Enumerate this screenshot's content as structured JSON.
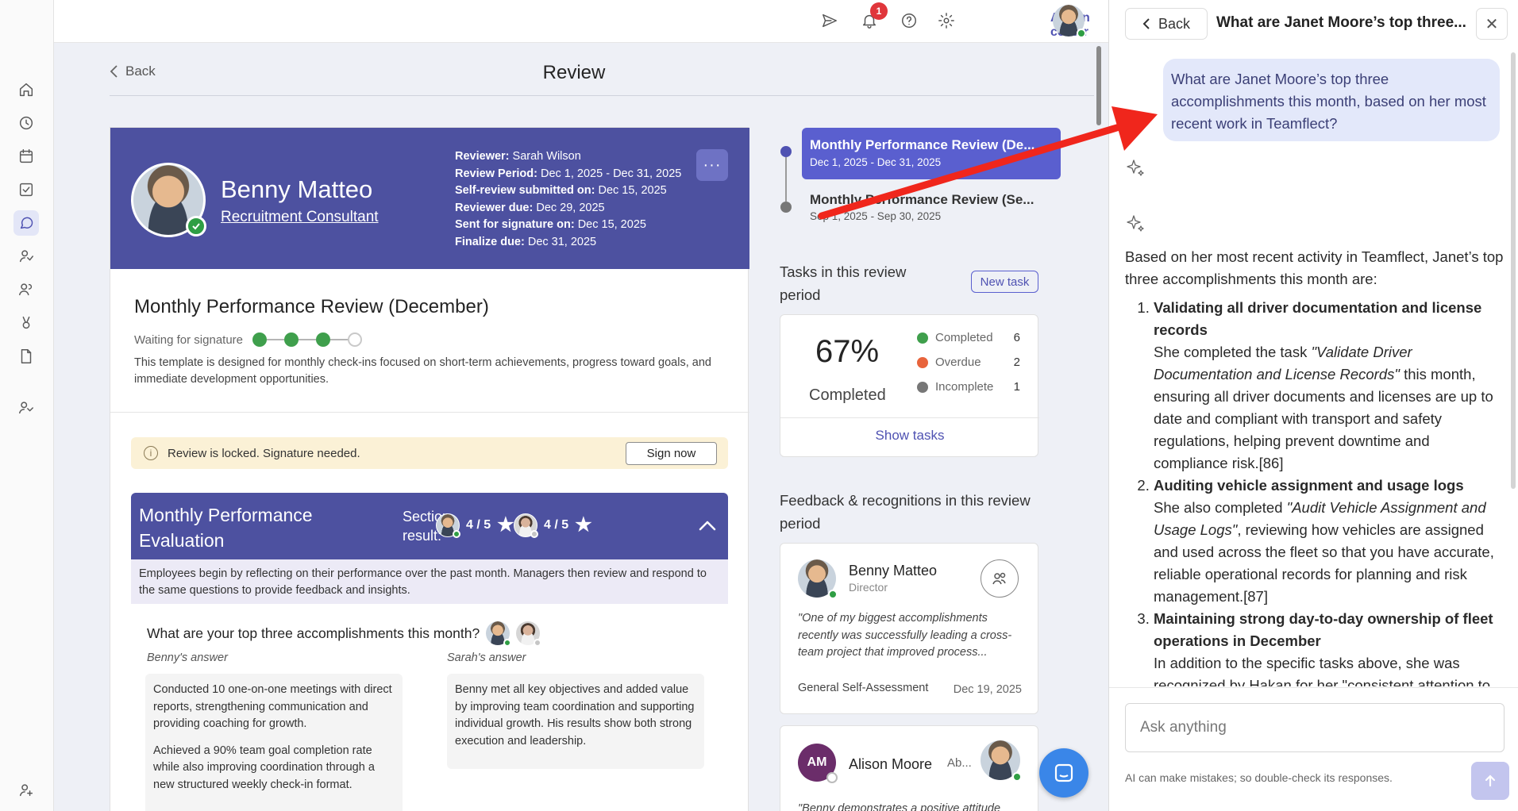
{
  "topbar": {
    "admin_label": "Admin center",
    "notification_count": "1"
  },
  "rail": {
    "items": [
      "home-icon",
      "activity-icon",
      "calendar-icon",
      "tasks-icon",
      "reviews-icon",
      "feedback-icon",
      "people-icon",
      "recognition-icon",
      "documents-icon",
      "team-icon",
      "add-user-icon"
    ]
  },
  "main": {
    "back_label": "Back",
    "page_title": "Review",
    "employee": {
      "name": "Benny Matteo",
      "role": "Recruitment Consultant"
    },
    "review_info": [
      {
        "label": "Reviewer:",
        "value": "Sarah Wilson"
      },
      {
        "label": "Review Period:",
        "value": "Dec 1, 2025 - Dec 31, 2025"
      },
      {
        "label": "Self-review submitted on:",
        "value": "Dec 15, 2025"
      },
      {
        "label": "Reviewer due:",
        "value": "Dec 29, 2025"
      },
      {
        "label": "Sent for signature on:",
        "value": "Dec 15, 2025"
      },
      {
        "label": "Finalize due:",
        "value": "Dec 31, 2025"
      }
    ],
    "more_label": "···",
    "review_title": "Monthly Performance Review (December)",
    "status_label": "Waiting for signature",
    "steps_completed": 3,
    "steps_total": 4,
    "review_description": "This template is designed for monthly check-ins focused on short-term achievements, progress toward goals, and immediate development opportunities.",
    "lock_text": "Review is locked. Signature needed.",
    "sign_label": "Sign now",
    "section": {
      "title": "Monthly Performance Evaluation",
      "result_label": "Section result:",
      "self_score": "4 / 5",
      "reviewer_score": "4 / 5",
      "description": "Employees begin by reflecting on their performance over the past month. Managers then review and respond to the same questions to provide feedback and insights."
    },
    "question": {
      "title": "What are your top three accomplishments this month?",
      "left_label": "Benny's answer",
      "right_label": "Sarah's answer",
      "left_answer_1": "Conducted 10 one-on-one meetings with direct reports, strengthening communication and providing coaching for growth.",
      "left_answer_2": "Achieved a 90% team goal completion rate while also improving coordination through a new structured weekly check-in format.",
      "right_answer": "Benny met all key objectives and added value by improving team coordination and supporting individual growth. His results show both strong execution and leadership."
    }
  },
  "sidebar_right": {
    "reviews": [
      {
        "title": "Monthly Performance Review (De...",
        "period": "Dec 1, 2025 - Dec 31, 2025"
      },
      {
        "title": "Monthly Performance Review (Se...",
        "period": "Sep 1, 2025 - Sep 30, 2025"
      }
    ],
    "tasks_title": "Tasks in this review period",
    "new_task_label": "New task",
    "completion_pct": "67%",
    "completion_label": "Completed",
    "legend": [
      {
        "label": "Completed",
        "count": "6",
        "color": "#3f9f4c"
      },
      {
        "label": "Overdue",
        "count": "2",
        "color": "#e8643c"
      },
      {
        "label": "Incomplete",
        "count": "1",
        "color": "#777777"
      }
    ],
    "show_tasks_label": "Show tasks",
    "feedback_title": "Feedback & recognitions in this review period",
    "feedback": [
      {
        "name": "Benny Matteo",
        "role": "Director",
        "quote": "\"One of my biggest accomplishments recently was successfully leading a cross-team project that improved process...",
        "source": "General Self-Assessment",
        "date": "Dec 19, 2025"
      },
      {
        "initials": "AM",
        "name": "Alison Moore",
        "abbr": "Ab...",
        "quote": "\"Benny demonstrates a positive attitude"
      }
    ]
  },
  "panel": {
    "back_label": "Back",
    "title": "What are Janet Moore’s top three...",
    "close_label": "✕",
    "user_message": "What are Janet Moore’s top three accomplishments this month, based on her most recent work in Teamflect?",
    "answer_intro": "Based on her most recent activity in Teamflect, Janet’s top three accomplishments this month are:",
    "answers": [
      {
        "heading": "Validating all driver documentation and license records",
        "pre": "She completed the task ",
        "em": "\"Validate Driver Documentation and License Records\"",
        "post": " this month, ensuring all driver documents and licenses are up to date and compliant with transport and safety regulations, helping prevent downtime and compliance risk.[86]"
      },
      {
        "heading": "Auditing vehicle assignment and usage logs",
        "pre": "She also completed ",
        "em": "\"Audit Vehicle Assignment and Usage Logs\"",
        "post": ", reviewing how vehicles are assigned and used across the fleet so that you have accurate, reliable operational records for planning and risk management.[87]"
      },
      {
        "heading": "Maintaining strong day-to-day ownership of fleet operations in December",
        "pre": "In addition to the specific tasks above, she was recognized by Hakan for her \"consistent attention to",
        "em": "",
        "post": ""
      }
    ],
    "ask_placeholder": "Ask anything",
    "disclaimer": "AI can make mistakes; so double-check its responses."
  },
  "colors": {
    "brand": "#4d51a0",
    "accent": "#5a5fcf",
    "annotation_arrow": "#f0261c"
  }
}
